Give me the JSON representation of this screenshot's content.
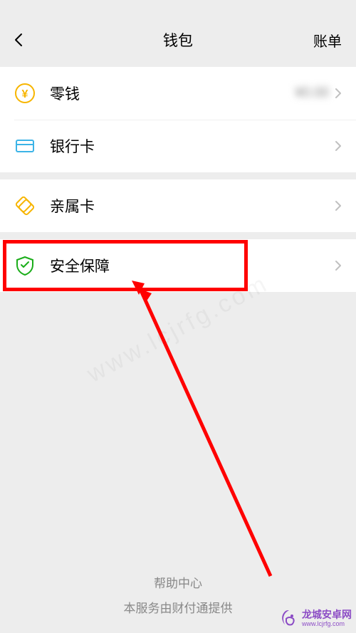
{
  "nav": {
    "title": "钱包",
    "action": "账单"
  },
  "rows": {
    "balance": {
      "label": "零钱",
      "value": "¥0.00"
    },
    "bankcard": {
      "label": "银行卡"
    },
    "familycard": {
      "label": "亲属卡"
    },
    "security": {
      "label": "安全保障"
    }
  },
  "footer": {
    "help": "帮助中心",
    "provider": "本服务由财付通提供"
  },
  "watermark": {
    "title": "龙城安卓网",
    "url": "www.lcjrfg.com",
    "diag": "www.lcjrfg.com"
  }
}
